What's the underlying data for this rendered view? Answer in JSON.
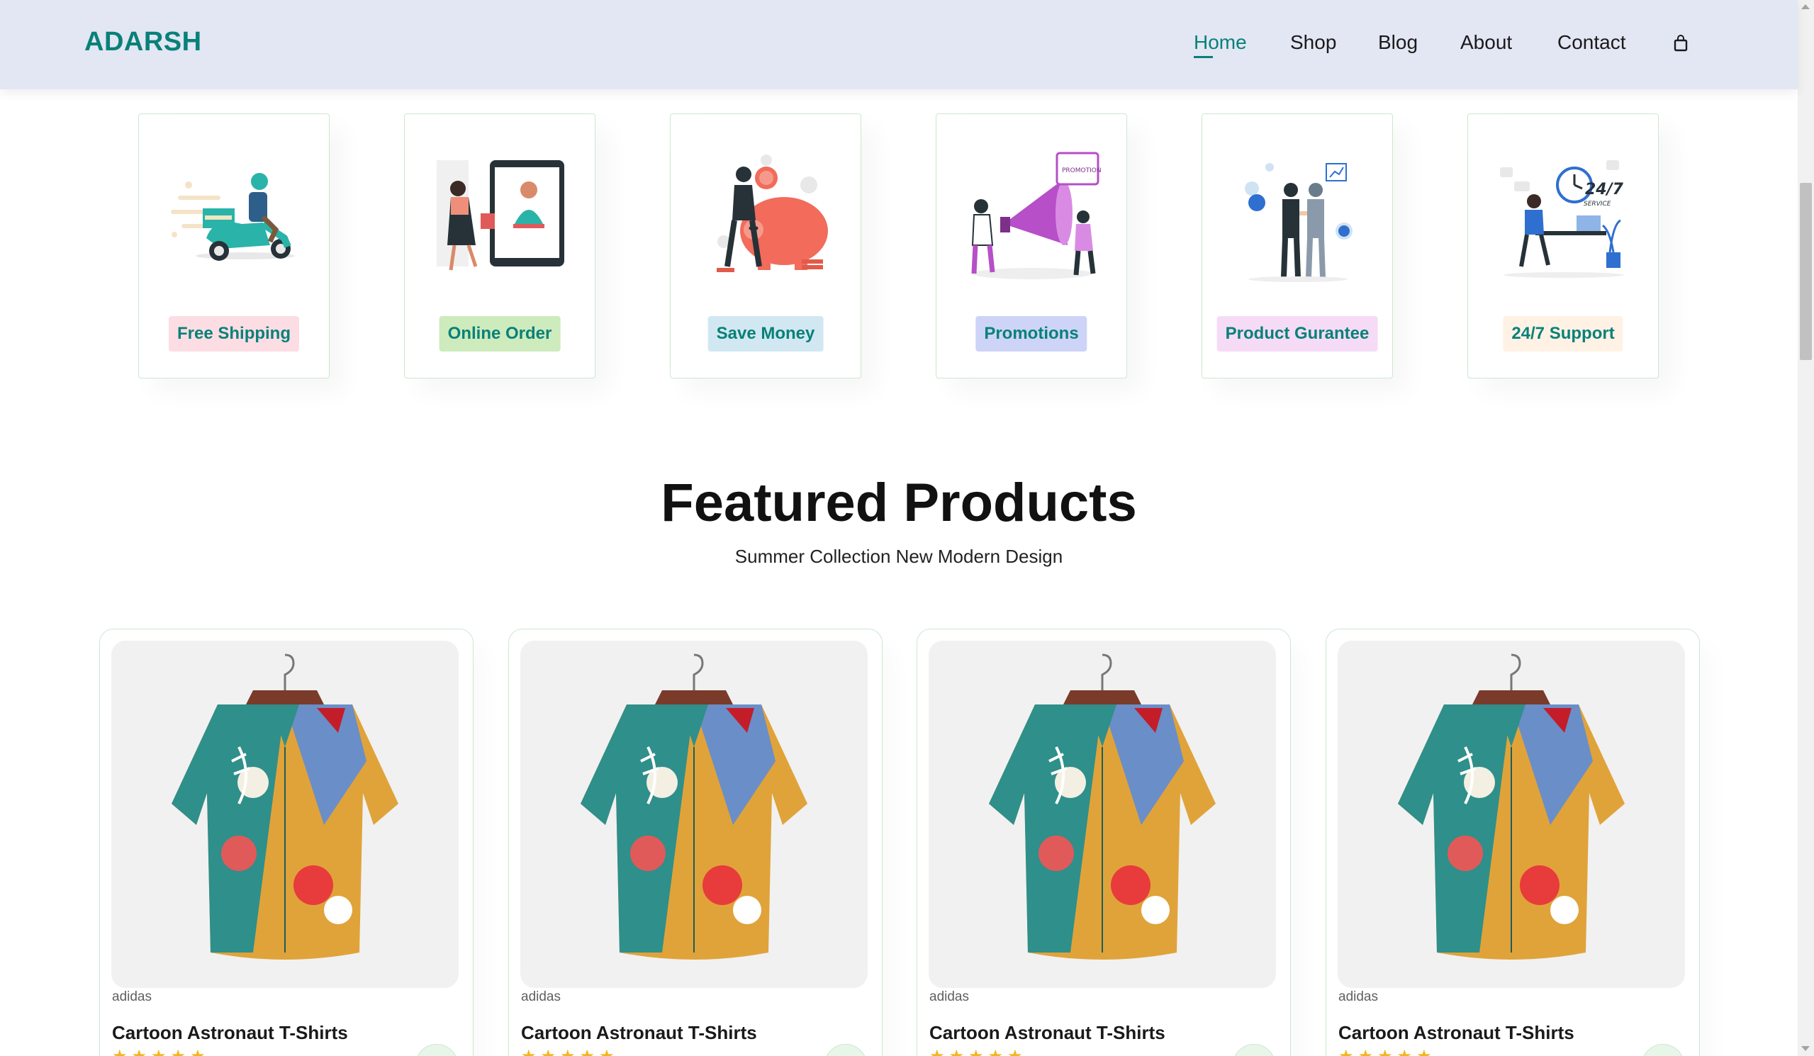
{
  "header": {
    "logo": "ADARSH",
    "nav": [
      "Home",
      "Shop",
      "Blog",
      "About",
      "Contact"
    ],
    "active": "Home",
    "cart_icon": "shopping-bag-icon"
  },
  "features": [
    {
      "label": "Free Shipping",
      "bg": "#fddde4",
      "icon": "delivery-scooter-illustration"
    },
    {
      "label": "Online Order",
      "bg": "#cdebbc",
      "icon": "online-order-illustration"
    },
    {
      "label": "Save Money",
      "bg": "#d1e8f2",
      "icon": "piggy-bank-illustration"
    },
    {
      "label": "Promotions",
      "bg": "#cdd4f8",
      "icon": "megaphone-illustration"
    },
    {
      "label": "Product Gurantee",
      "bg": "#f6dbf6",
      "icon": "handshake-illustration"
    },
    {
      "label": "24/7 Support",
      "bg": "#fff2e5",
      "icon": "support-clock-illustration"
    }
  ],
  "section": {
    "title": "Featured Products",
    "subtitle": "Summer Collection New Modern Design"
  },
  "products": [
    {
      "brand": "adidas",
      "name": "Cartoon Astronaut T-Shirts",
      "rating": 5
    },
    {
      "brand": "adidas",
      "name": "Cartoon Astronaut T-Shirts",
      "rating": 5
    },
    {
      "brand": "adidas",
      "name": "Cartoon Astronaut T-Shirts",
      "rating": 5
    },
    {
      "brand": "adidas",
      "name": "Cartoon Astronaut T-Shirts",
      "rating": 5
    }
  ],
  "colors": {
    "accent": "#088178",
    "header_bg": "#e3e6f3",
    "star": "#f3b519"
  }
}
